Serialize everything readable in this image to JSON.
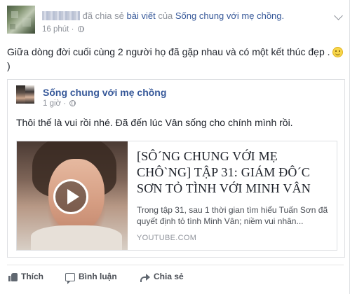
{
  "post": {
    "verb_prefix": " đã chia sẻ ",
    "object_link": "bài viết",
    "verb_suffix": " của ",
    "page_link": "Sống chung với mẹ chồng.",
    "time": "16 phút · ",
    "message": "Giữa dòng đời cuối cùng 2 người họ đã gặp nhau và có một kết thúc đẹp . ",
    "message_end": ")"
  },
  "shared_post": {
    "page_name": "Sống chung với mẹ chồng",
    "time": "1 giờ · ",
    "text": "Thôi thế là vui rồi nhé. Đã đến lúc Vân sống cho chính mình rồi."
  },
  "link_preview": {
    "title": "[SÔ´NG CHUNG VỚI MẸ CHÔ`NG] TẬP 31: GIÁM ĐÔ´C SƠN TỎ TÌNH VỚI MINH VÂN",
    "description": "Trong tập 31, sau 1 thời gian tìm hiểu Tuấn Sơn đã quyết định tỏ tình Minh Vân; niềm vui nhân...",
    "domain": "YOUTUBE.COM"
  },
  "actions": {
    "like": "Thích",
    "comment": "Bình luận",
    "share": "Chia sẻ"
  },
  "icons": {
    "audience": "globe-icon",
    "emoji": "smiley-icon",
    "play": "play-icon",
    "like": "thumbs-up-icon",
    "comment": "comment-icon",
    "share": "share-arrow-icon"
  },
  "colors": {
    "link": "#365899",
    "meta": "#90949c",
    "text": "#1d2129"
  }
}
